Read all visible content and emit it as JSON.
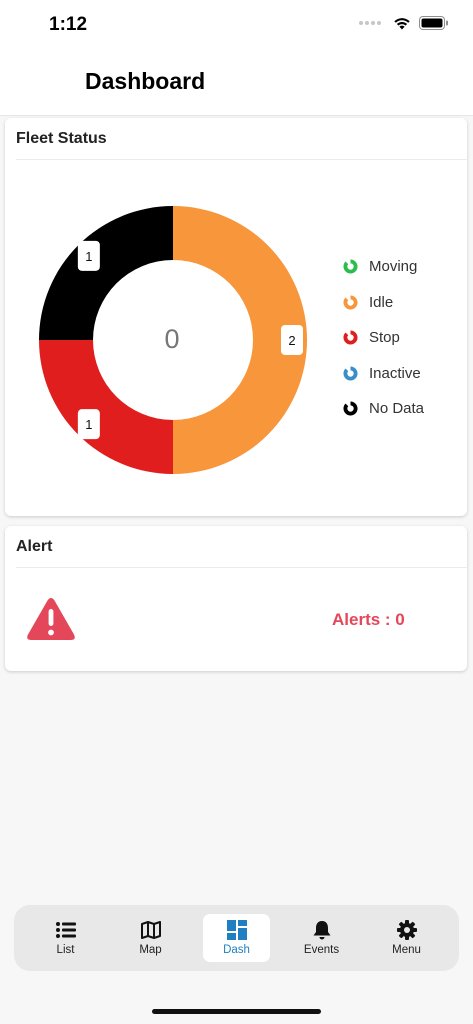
{
  "status_bar": {
    "time": "1:12"
  },
  "header": {
    "title": "Dashboard"
  },
  "fleet_status": {
    "title": "Fleet Status",
    "center_value": "0",
    "chart_data": {
      "type": "pie",
      "categories": [
        "Idle",
        "Stop",
        "No Data"
      ],
      "values": [
        2,
        1,
        1
      ],
      "colors": [
        "#f7963b",
        "#e01e1e",
        "#000000"
      ]
    },
    "legend": [
      {
        "label": "Moving",
        "color": "#2dbd4e"
      },
      {
        "label": "Idle",
        "color": "#f7963b"
      },
      {
        "label": "Stop",
        "color": "#e01e1e"
      },
      {
        "label": "Inactive",
        "color": "#3a8ec9"
      },
      {
        "label": "No Data",
        "color": "#000000"
      }
    ]
  },
  "alert": {
    "title": "Alert",
    "count_text": "Alerts : 0",
    "icon": "warning-icon",
    "color": "#e5475a"
  },
  "tabs": [
    {
      "label": "List",
      "icon": "list-icon",
      "active": false
    },
    {
      "label": "Map",
      "icon": "map-icon",
      "active": false
    },
    {
      "label": "Dash",
      "icon": "dashboard-icon",
      "active": true
    },
    {
      "label": "Events",
      "icon": "bell-icon",
      "active": false
    },
    {
      "label": "Menu",
      "icon": "gear-icon",
      "active": false
    }
  ],
  "accent_color": "#1f7fc1"
}
